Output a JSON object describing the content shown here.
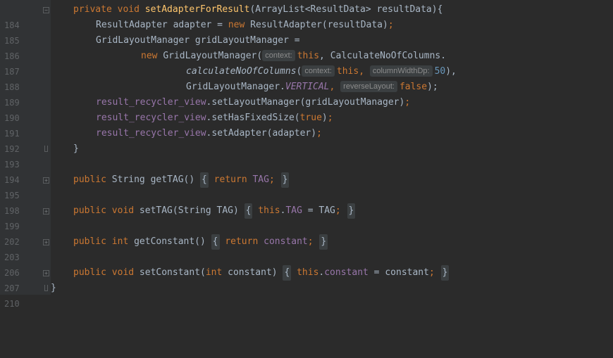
{
  "lines": [
    {
      "n": "184",
      "fold": "open"
    },
    {
      "n": "185"
    },
    {
      "n": "186"
    },
    {
      "n": "187"
    },
    {
      "n": "188"
    },
    {
      "n": "189"
    },
    {
      "n": "190"
    },
    {
      "n": "191"
    },
    {
      "n": "192"
    },
    {
      "n": "193",
      "fold": "end"
    },
    {
      "n": "194"
    },
    {
      "n": "195",
      "fold": "collapsed"
    },
    {
      "n": "198"
    },
    {
      "n": "199",
      "fold": "collapsed"
    },
    {
      "n": "202"
    },
    {
      "n": "203",
      "fold": "collapsed"
    },
    {
      "n": "206"
    },
    {
      "n": "207",
      "fold": "collapsed"
    },
    {
      "n": "210",
      "fold": "end"
    }
  ],
  "code": {
    "l184": {
      "a": "private void ",
      "b": "setAdapterForResult",
      "c": "(ArrayList<ResultData> resultData){"
    },
    "l185": {
      "a": "ResultAdapter adapter = ",
      "b": "new ",
      "c": "ResultAdapter(resultData)",
      "d": ";"
    },
    "l186": {
      "a": "GridLayoutManager gridLayoutManager ="
    },
    "l187": {
      "a": "new ",
      "b": "GridLayoutManager(",
      "hint": "context:",
      "c": "this",
      ",": ", CalculateNoOfColumns."
    },
    "l188": {
      "call": "calculateNoOfColumns",
      "p": "(",
      "hint1": "context:",
      "t": "this",
      ",": ", ",
      "hint2": "columnWidthDp:",
      "num": "50",
      "end": "),"
    },
    "l189": {
      "a": "GridLayoutManager.",
      "f": "VERTICAL",
      ",": ", ",
      "hint": "reverseLayout:",
      "v": "false",
      "end": ");"
    },
    "l190": {
      "f": "result_recycler_view",
      ".": ".setLayoutManager(gridLayoutManager)",
      "s": ";"
    },
    "l191": {
      "f": "result_recycler_view",
      ".": ".setHasFixedSize(",
      "v": "true",
      "end": ")",
      "s": ";"
    },
    "l192": {
      "f": "result_recycler_view",
      ".": ".setAdapter(adapter)",
      "s": ";"
    },
    "l193": {
      "a": "}"
    },
    "l195": {
      "kw": "public ",
      "type": "String getTAG() ",
      "ob": "{",
      "ret": " return ",
      "f": "TAG",
      "s": ";",
      "cb": "}"
    },
    "l199": {
      "kw": "public void ",
      "m": "setTAG(String TAG) ",
      "ob": "{",
      "t": " this",
      ".": ".",
      "f": "TAG",
      " = ": " = TAG",
      "s": ";",
      "cb": "}"
    },
    "l203": {
      "kw": "public int ",
      "m": "getConstant() ",
      "ob": "{",
      "ret": " return ",
      "f": "constant",
      "s": ";",
      "cb": "}"
    },
    "l207": {
      "kw": "public void ",
      "m": "setConstant(",
      "int": "int ",
      "rest": "constant) ",
      "ob": "{",
      "t": " this",
      ".": ".",
      "f": "constant",
      " = ": " = constant",
      "s": ";",
      "cb": "}"
    },
    "l210": {
      "a": "}"
    }
  }
}
